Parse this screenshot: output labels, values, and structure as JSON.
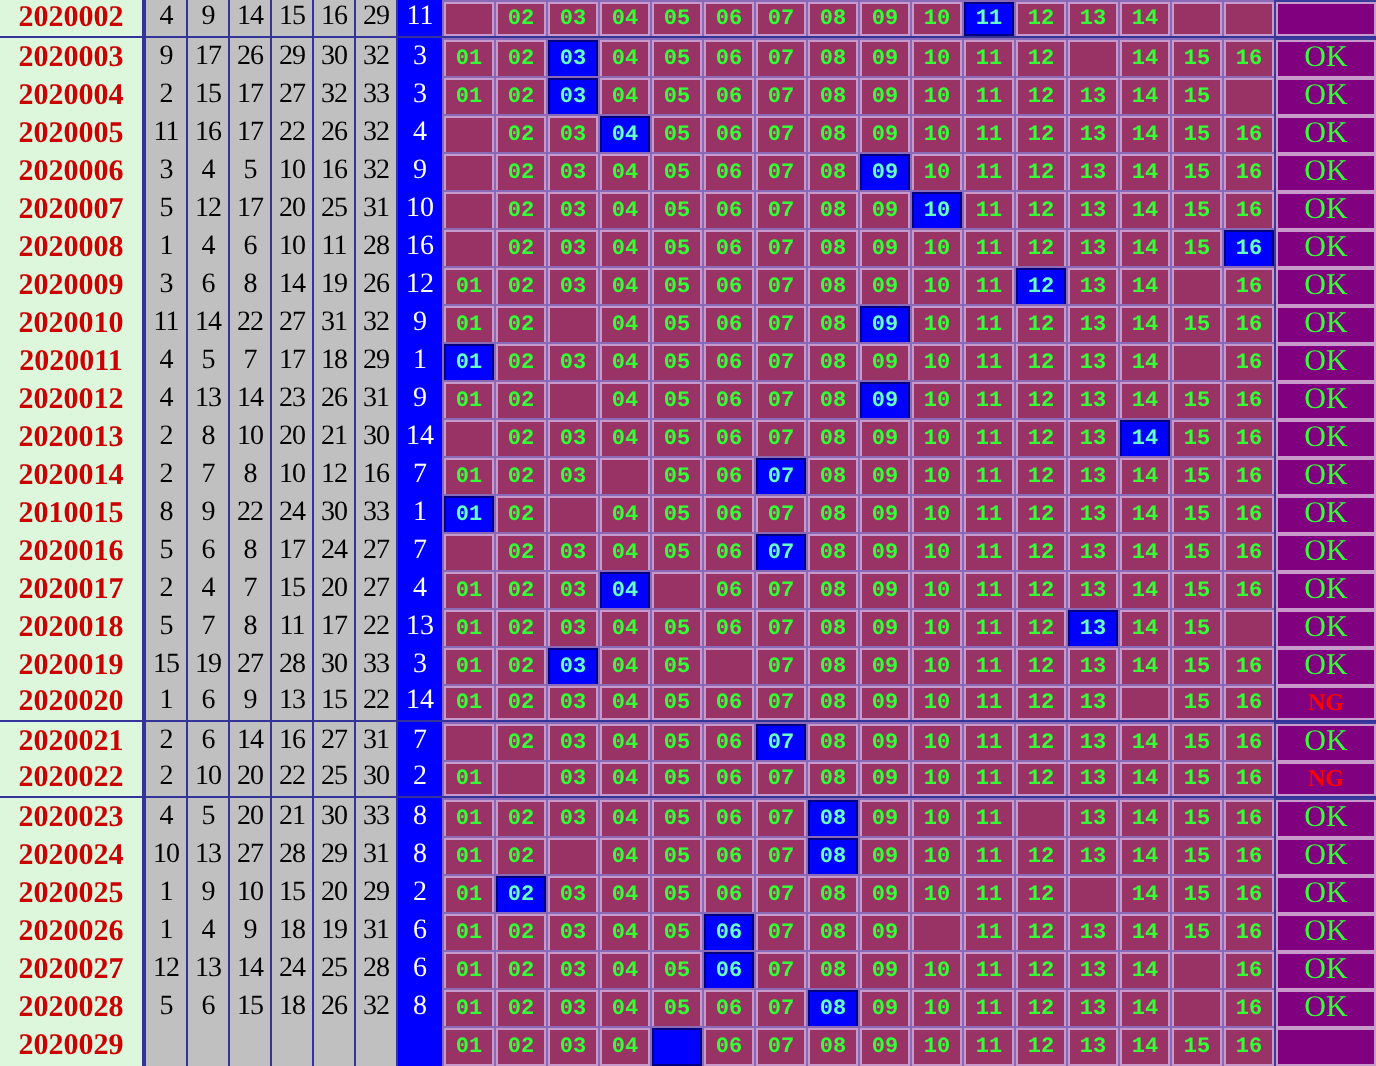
{
  "rows": [
    {
      "issue": "2020002",
      "reds": [
        "4",
        "9",
        "14",
        "15",
        "16",
        "29"
      ],
      "blue": "11",
      "cells": [
        {
          "hit": false
        },
        {
          "text": "02",
          "hit": false
        },
        {
          "text": "03",
          "hit": false
        },
        {
          "text": "04",
          "hit": false
        },
        {
          "text": "05",
          "hit": false
        },
        {
          "text": "06",
          "hit": false
        },
        {
          "text": "07",
          "hit": false
        },
        {
          "text": "08",
          "hit": false
        },
        {
          "text": "09",
          "hit": false
        },
        {
          "text": "10",
          "hit": false
        },
        {
          "text": "11",
          "hit": true
        },
        {
          "text": "12",
          "hit": false
        },
        {
          "text": "13",
          "hit": false
        },
        {
          "text": "14",
          "hit": false
        },
        {
          "hit": false
        },
        {
          "hit": false
        }
      ]
    },
    {
      "issue": "2020003",
      "reds": [
        "9",
        "17",
        "26",
        "29",
        "30",
        "32"
      ],
      "blue": "3",
      "cells": [
        {
          "text": "01",
          "hit": false
        },
        {
          "text": "02",
          "hit": false
        },
        {
          "text": "03",
          "hit": true
        },
        {
          "text": "04",
          "hit": false
        },
        {
          "text": "05",
          "hit": false
        },
        {
          "text": "06",
          "hit": false
        },
        {
          "text": "07",
          "hit": false
        },
        {
          "text": "08",
          "hit": false
        },
        {
          "text": "09",
          "hit": false
        },
        {
          "text": "10",
          "hit": false
        },
        {
          "text": "11",
          "hit": false
        },
        {
          "text": "12",
          "hit": false
        },
        {
          "hit": false
        },
        {
          "text": "14",
          "hit": false
        },
        {
          "text": "15",
          "hit": false
        },
        {
          "text": "16",
          "hit": false
        }
      ],
      "status": {
        "text": "OK",
        "kind": "ok"
      }
    },
    {
      "issue": "2020004",
      "reds": [
        "2",
        "15",
        "17",
        "27",
        "32",
        "33"
      ],
      "blue": "3",
      "cells": [
        {
          "text": "01",
          "hit": false
        },
        {
          "text": "02",
          "hit": false
        },
        {
          "text": "03",
          "hit": true
        },
        {
          "text": "04",
          "hit": false
        },
        {
          "text": "05",
          "hit": false
        },
        {
          "text": "06",
          "hit": false
        },
        {
          "text": "07",
          "hit": false
        },
        {
          "text": "08",
          "hit": false
        },
        {
          "text": "09",
          "hit": false
        },
        {
          "text": "10",
          "hit": false
        },
        {
          "text": "11",
          "hit": false
        },
        {
          "text": "12",
          "hit": false
        },
        {
          "text": "13",
          "hit": false
        },
        {
          "text": "14",
          "hit": false
        },
        {
          "text": "15",
          "hit": false
        },
        {
          "hit": false
        }
      ],
      "status": {
        "text": "OK",
        "kind": "ok"
      }
    },
    {
      "issue": "2020005",
      "reds": [
        "11",
        "16",
        "17",
        "22",
        "26",
        "32"
      ],
      "blue": "4",
      "cells": [
        {
          "hit": false
        },
        {
          "text": "02",
          "hit": false
        },
        {
          "text": "03",
          "hit": false
        },
        {
          "text": "04",
          "hit": true
        },
        {
          "text": "05",
          "hit": false
        },
        {
          "text": "06",
          "hit": false
        },
        {
          "text": "07",
          "hit": false
        },
        {
          "text": "08",
          "hit": false
        },
        {
          "text": "09",
          "hit": false
        },
        {
          "text": "10",
          "hit": false
        },
        {
          "text": "11",
          "hit": false
        },
        {
          "text": "12",
          "hit": false
        },
        {
          "text": "13",
          "hit": false
        },
        {
          "text": "14",
          "hit": false
        },
        {
          "text": "15",
          "hit": false
        },
        {
          "text": "16",
          "hit": false
        }
      ],
      "status": {
        "text": "OK",
        "kind": "ok"
      }
    },
    {
      "issue": "2020006",
      "reds": [
        "3",
        "4",
        "5",
        "10",
        "16",
        "32"
      ],
      "blue": "9",
      "cells": [
        {
          "hit": false
        },
        {
          "text": "02",
          "hit": false
        },
        {
          "text": "03",
          "hit": false
        },
        {
          "text": "04",
          "hit": false
        },
        {
          "text": "05",
          "hit": false
        },
        {
          "text": "06",
          "hit": false
        },
        {
          "text": "07",
          "hit": false
        },
        {
          "text": "08",
          "hit": false
        },
        {
          "text": "09",
          "hit": true
        },
        {
          "text": "10",
          "hit": false
        },
        {
          "text": "11",
          "hit": false
        },
        {
          "text": "12",
          "hit": false
        },
        {
          "text": "13",
          "hit": false
        },
        {
          "text": "14",
          "hit": false
        },
        {
          "text": "15",
          "hit": false
        },
        {
          "text": "16",
          "hit": false
        }
      ],
      "status": {
        "text": "OK",
        "kind": "ok"
      }
    },
    {
      "issue": "2020007",
      "reds": [
        "5",
        "12",
        "17",
        "20",
        "25",
        "31"
      ],
      "blue": "10",
      "cells": [
        {
          "hit": false
        },
        {
          "text": "02",
          "hit": false
        },
        {
          "text": "03",
          "hit": false
        },
        {
          "text": "04",
          "hit": false
        },
        {
          "text": "05",
          "hit": false
        },
        {
          "text": "06",
          "hit": false
        },
        {
          "text": "07",
          "hit": false
        },
        {
          "text": "08",
          "hit": false
        },
        {
          "text": "09",
          "hit": false
        },
        {
          "text": "10",
          "hit": true
        },
        {
          "text": "11",
          "hit": false
        },
        {
          "text": "12",
          "hit": false
        },
        {
          "text": "13",
          "hit": false
        },
        {
          "text": "14",
          "hit": false
        },
        {
          "text": "15",
          "hit": false
        },
        {
          "text": "16",
          "hit": false
        }
      ],
      "status": {
        "text": "OK",
        "kind": "ok"
      }
    },
    {
      "issue": "2020008",
      "reds": [
        "1",
        "4",
        "6",
        "10",
        "11",
        "28"
      ],
      "blue": "16",
      "cells": [
        {
          "hit": false
        },
        {
          "text": "02",
          "hit": false
        },
        {
          "text": "03",
          "hit": false
        },
        {
          "text": "04",
          "hit": false
        },
        {
          "text": "05",
          "hit": false
        },
        {
          "text": "06",
          "hit": false
        },
        {
          "text": "07",
          "hit": false
        },
        {
          "text": "08",
          "hit": false
        },
        {
          "text": "09",
          "hit": false
        },
        {
          "text": "10",
          "hit": false
        },
        {
          "text": "11",
          "hit": false
        },
        {
          "text": "12",
          "hit": false
        },
        {
          "text": "13",
          "hit": false
        },
        {
          "text": "14",
          "hit": false
        },
        {
          "text": "15",
          "hit": false
        },
        {
          "text": "16",
          "hit": true
        }
      ],
      "status": {
        "text": "OK",
        "kind": "ok"
      }
    },
    {
      "issue": "2020009",
      "reds": [
        "3",
        "6",
        "8",
        "14",
        "19",
        "26"
      ],
      "blue": "12",
      "cells": [
        {
          "text": "01",
          "hit": false
        },
        {
          "text": "02",
          "hit": false
        },
        {
          "text": "03",
          "hit": false
        },
        {
          "text": "04",
          "hit": false
        },
        {
          "text": "05",
          "hit": false
        },
        {
          "text": "06",
          "hit": false
        },
        {
          "text": "07",
          "hit": false
        },
        {
          "text": "08",
          "hit": false
        },
        {
          "text": "09",
          "hit": false
        },
        {
          "text": "10",
          "hit": false
        },
        {
          "text": "11",
          "hit": false
        },
        {
          "text": "12",
          "hit": true
        },
        {
          "text": "13",
          "hit": false
        },
        {
          "text": "14",
          "hit": false
        },
        {
          "hit": false
        },
        {
          "text": "16",
          "hit": false
        }
      ],
      "status": {
        "text": "OK",
        "kind": "ok"
      }
    },
    {
      "issue": "2020010",
      "reds": [
        "11",
        "14",
        "22",
        "27",
        "31",
        "32"
      ],
      "blue": "9",
      "cells": [
        {
          "text": "01",
          "hit": false
        },
        {
          "text": "02",
          "hit": false
        },
        {
          "hit": false
        },
        {
          "text": "04",
          "hit": false
        },
        {
          "text": "05",
          "hit": false
        },
        {
          "text": "06",
          "hit": false
        },
        {
          "text": "07",
          "hit": false
        },
        {
          "text": "08",
          "hit": false
        },
        {
          "text": "09",
          "hit": true
        },
        {
          "text": "10",
          "hit": false
        },
        {
          "text": "11",
          "hit": false
        },
        {
          "text": "12",
          "hit": false
        },
        {
          "text": "13",
          "hit": false
        },
        {
          "text": "14",
          "hit": false
        },
        {
          "text": "15",
          "hit": false
        },
        {
          "text": "16",
          "hit": false
        }
      ],
      "status": {
        "text": "OK",
        "kind": "ok"
      }
    },
    {
      "issue": "2020011",
      "reds": [
        "4",
        "5",
        "7",
        "17",
        "18",
        "29"
      ],
      "blue": "1",
      "cells": [
        {
          "text": "01",
          "hit": true
        },
        {
          "text": "02",
          "hit": false
        },
        {
          "text": "03",
          "hit": false
        },
        {
          "text": "04",
          "hit": false
        },
        {
          "text": "05",
          "hit": false
        },
        {
          "text": "06",
          "hit": false
        },
        {
          "text": "07",
          "hit": false
        },
        {
          "text": "08",
          "hit": false
        },
        {
          "text": "09",
          "hit": false
        },
        {
          "text": "10",
          "hit": false
        },
        {
          "text": "11",
          "hit": false
        },
        {
          "text": "12",
          "hit": false
        },
        {
          "text": "13",
          "hit": false
        },
        {
          "text": "14",
          "hit": false
        },
        {
          "hit": false
        },
        {
          "text": "16",
          "hit": false
        }
      ],
      "status": {
        "text": "OK",
        "kind": "ok"
      }
    },
    {
      "issue": "2020012",
      "reds": [
        "4",
        "13",
        "14",
        "23",
        "26",
        "31"
      ],
      "blue": "9",
      "cells": [
        {
          "text": "01",
          "hit": false
        },
        {
          "text": "02",
          "hit": false
        },
        {
          "hit": false
        },
        {
          "text": "04",
          "hit": false
        },
        {
          "text": "05",
          "hit": false
        },
        {
          "text": "06",
          "hit": false
        },
        {
          "text": "07",
          "hit": false
        },
        {
          "text": "08",
          "hit": false
        },
        {
          "text": "09",
          "hit": true
        },
        {
          "text": "10",
          "hit": false
        },
        {
          "text": "11",
          "hit": false
        },
        {
          "text": "12",
          "hit": false
        },
        {
          "text": "13",
          "hit": false
        },
        {
          "text": "14",
          "hit": false
        },
        {
          "text": "15",
          "hit": false
        },
        {
          "text": "16",
          "hit": false
        }
      ],
      "status": {
        "text": "OK",
        "kind": "ok"
      }
    },
    {
      "issue": "2020013",
      "reds": [
        "2",
        "8",
        "10",
        "20",
        "21",
        "30"
      ],
      "blue": "14",
      "cells": [
        {
          "hit": false
        },
        {
          "text": "02",
          "hit": false
        },
        {
          "text": "03",
          "hit": false
        },
        {
          "text": "04",
          "hit": false
        },
        {
          "text": "05",
          "hit": false
        },
        {
          "text": "06",
          "hit": false
        },
        {
          "text": "07",
          "hit": false
        },
        {
          "text": "08",
          "hit": false
        },
        {
          "text": "09",
          "hit": false
        },
        {
          "text": "10",
          "hit": false
        },
        {
          "text": "11",
          "hit": false
        },
        {
          "text": "12",
          "hit": false
        },
        {
          "text": "13",
          "hit": false
        },
        {
          "text": "14",
          "hit": true
        },
        {
          "text": "15",
          "hit": false
        },
        {
          "text": "16",
          "hit": false
        }
      ],
      "status": {
        "text": "OK",
        "kind": "ok"
      }
    },
    {
      "issue": "2020014",
      "reds": [
        "2",
        "7",
        "8",
        "10",
        "12",
        "16"
      ],
      "blue": "7",
      "cells": [
        {
          "text": "01",
          "hit": false
        },
        {
          "text": "02",
          "hit": false
        },
        {
          "text": "03",
          "hit": false
        },
        {
          "hit": false
        },
        {
          "text": "05",
          "hit": false
        },
        {
          "text": "06",
          "hit": false
        },
        {
          "text": "07",
          "hit": true
        },
        {
          "text": "08",
          "hit": false
        },
        {
          "text": "09",
          "hit": false
        },
        {
          "text": "10",
          "hit": false
        },
        {
          "text": "11",
          "hit": false
        },
        {
          "text": "12",
          "hit": false
        },
        {
          "text": "13",
          "hit": false
        },
        {
          "text": "14",
          "hit": false
        },
        {
          "text": "15",
          "hit": false
        },
        {
          "text": "16",
          "hit": false
        }
      ],
      "status": {
        "text": "OK",
        "kind": "ok"
      }
    },
    {
      "issue": "2010015",
      "reds": [
        "8",
        "9",
        "22",
        "24",
        "30",
        "33"
      ],
      "blue": "1",
      "cells": [
        {
          "text": "01",
          "hit": true
        },
        {
          "text": "02",
          "hit": false
        },
        {
          "hit": false
        },
        {
          "text": "04",
          "hit": false
        },
        {
          "text": "05",
          "hit": false
        },
        {
          "text": "06",
          "hit": false
        },
        {
          "text": "07",
          "hit": false
        },
        {
          "text": "08",
          "hit": false
        },
        {
          "text": "09",
          "hit": false
        },
        {
          "text": "10",
          "hit": false
        },
        {
          "text": "11",
          "hit": false
        },
        {
          "text": "12",
          "hit": false
        },
        {
          "text": "13",
          "hit": false
        },
        {
          "text": "14",
          "hit": false
        },
        {
          "text": "15",
          "hit": false
        },
        {
          "text": "16",
          "hit": false
        }
      ],
      "status": {
        "text": "OK",
        "kind": "ok"
      }
    },
    {
      "issue": "2020016",
      "reds": [
        "5",
        "6",
        "8",
        "17",
        "24",
        "27"
      ],
      "blue": "7",
      "cells": [
        {
          "hit": false
        },
        {
          "text": "02",
          "hit": false
        },
        {
          "text": "03",
          "hit": false
        },
        {
          "text": "04",
          "hit": false
        },
        {
          "text": "05",
          "hit": false
        },
        {
          "text": "06",
          "hit": false
        },
        {
          "text": "07",
          "hit": true
        },
        {
          "text": "08",
          "hit": false
        },
        {
          "text": "09",
          "hit": false
        },
        {
          "text": "10",
          "hit": false
        },
        {
          "text": "11",
          "hit": false
        },
        {
          "text": "12",
          "hit": false
        },
        {
          "text": "13",
          "hit": false
        },
        {
          "text": "14",
          "hit": false
        },
        {
          "text": "15",
          "hit": false
        },
        {
          "text": "16",
          "hit": false
        }
      ],
      "status": {
        "text": "OK",
        "kind": "ok"
      }
    },
    {
      "issue": "2020017",
      "reds": [
        "2",
        "4",
        "7",
        "15",
        "20",
        "27"
      ],
      "blue": "4",
      "cells": [
        {
          "text": "01",
          "hit": false
        },
        {
          "text": "02",
          "hit": false
        },
        {
          "text": "03",
          "hit": false
        },
        {
          "text": "04",
          "hit": true
        },
        {
          "hit": false
        },
        {
          "text": "06",
          "hit": false
        },
        {
          "text": "07",
          "hit": false
        },
        {
          "text": "08",
          "hit": false
        },
        {
          "text": "09",
          "hit": false
        },
        {
          "text": "10",
          "hit": false
        },
        {
          "text": "11",
          "hit": false
        },
        {
          "text": "12",
          "hit": false
        },
        {
          "text": "13",
          "hit": false
        },
        {
          "text": "14",
          "hit": false
        },
        {
          "text": "15",
          "hit": false
        },
        {
          "text": "16",
          "hit": false
        }
      ],
      "status": {
        "text": "OK",
        "kind": "ok"
      }
    },
    {
      "issue": "2020018",
      "reds": [
        "5",
        "7",
        "8",
        "11",
        "17",
        "22"
      ],
      "blue": "13",
      "cells": [
        {
          "text": "01",
          "hit": false
        },
        {
          "text": "02",
          "hit": false
        },
        {
          "text": "03",
          "hit": false
        },
        {
          "text": "04",
          "hit": false
        },
        {
          "text": "05",
          "hit": false
        },
        {
          "text": "06",
          "hit": false
        },
        {
          "text": "07",
          "hit": false
        },
        {
          "text": "08",
          "hit": false
        },
        {
          "text": "09",
          "hit": false
        },
        {
          "text": "10",
          "hit": false
        },
        {
          "text": "11",
          "hit": false
        },
        {
          "text": "12",
          "hit": false
        },
        {
          "text": "13",
          "hit": true
        },
        {
          "text": "14",
          "hit": false
        },
        {
          "text": "15",
          "hit": false
        },
        {
          "hit": false
        }
      ],
      "status": {
        "text": "OK",
        "kind": "ok"
      }
    },
    {
      "issue": "2020019",
      "reds": [
        "15",
        "19",
        "27",
        "28",
        "30",
        "33"
      ],
      "blue": "3",
      "cells": [
        {
          "text": "01",
          "hit": false
        },
        {
          "text": "02",
          "hit": false
        },
        {
          "text": "03",
          "hit": true
        },
        {
          "text": "04",
          "hit": false
        },
        {
          "text": "05",
          "hit": false
        },
        {
          "hit": false
        },
        {
          "text": "07",
          "hit": false
        },
        {
          "text": "08",
          "hit": false
        },
        {
          "text": "09",
          "hit": false
        },
        {
          "text": "10",
          "hit": false
        },
        {
          "text": "11",
          "hit": false
        },
        {
          "text": "12",
          "hit": false
        },
        {
          "text": "13",
          "hit": false
        },
        {
          "text": "14",
          "hit": false
        },
        {
          "text": "15",
          "hit": false
        },
        {
          "text": "16",
          "hit": false
        }
      ],
      "status": {
        "text": "OK",
        "kind": "ok"
      }
    },
    {
      "issue": "2020020",
      "reds": [
        "1",
        "6",
        "9",
        "13",
        "15",
        "22"
      ],
      "blue": "14",
      "cells": [
        {
          "text": "01",
          "hit": false
        },
        {
          "text": "02",
          "hit": false
        },
        {
          "text": "03",
          "hit": false
        },
        {
          "text": "04",
          "hit": false
        },
        {
          "text": "05",
          "hit": false
        },
        {
          "text": "06",
          "hit": false
        },
        {
          "text": "07",
          "hit": false
        },
        {
          "text": "08",
          "hit": false
        },
        {
          "text": "09",
          "hit": false
        },
        {
          "text": "10",
          "hit": false
        },
        {
          "text": "11",
          "hit": false
        },
        {
          "text": "12",
          "hit": false
        },
        {
          "text": "13",
          "hit": false
        },
        {
          "hit": false
        },
        {
          "text": "15",
          "hit": false
        },
        {
          "text": "16",
          "hit": false
        }
      ],
      "status": {
        "text": "NG",
        "kind": "ng"
      }
    },
    {
      "issue": "2020021",
      "reds": [
        "2",
        "6",
        "14",
        "16",
        "27",
        "31"
      ],
      "blue": "7",
      "cells": [
        {
          "hit": false
        },
        {
          "text": "02",
          "hit": false
        },
        {
          "text": "03",
          "hit": false
        },
        {
          "text": "04",
          "hit": false
        },
        {
          "text": "05",
          "hit": false
        },
        {
          "text": "06",
          "hit": false
        },
        {
          "text": "07",
          "hit": true
        },
        {
          "text": "08",
          "hit": false
        },
        {
          "text": "09",
          "hit": false
        },
        {
          "text": "10",
          "hit": false
        },
        {
          "text": "11",
          "hit": false
        },
        {
          "text": "12",
          "hit": false
        },
        {
          "text": "13",
          "hit": false
        },
        {
          "text": "14",
          "hit": false
        },
        {
          "text": "15",
          "hit": false
        },
        {
          "text": "16",
          "hit": false
        }
      ],
      "status": {
        "text": "OK",
        "kind": "ok"
      }
    },
    {
      "issue": "2020022",
      "reds": [
        "2",
        "10",
        "20",
        "22",
        "25",
        "30"
      ],
      "blue": "2",
      "cells": [
        {
          "text": "01",
          "hit": false
        },
        {
          "hit": false
        },
        {
          "text": "03",
          "hit": false
        },
        {
          "text": "04",
          "hit": false
        },
        {
          "text": "05",
          "hit": false
        },
        {
          "text": "06",
          "hit": false
        },
        {
          "text": "07",
          "hit": false
        },
        {
          "text": "08",
          "hit": false
        },
        {
          "text": "09",
          "hit": false
        },
        {
          "text": "10",
          "hit": false
        },
        {
          "text": "11",
          "hit": false
        },
        {
          "text": "12",
          "hit": false
        },
        {
          "text": "13",
          "hit": false
        },
        {
          "text": "14",
          "hit": false
        },
        {
          "text": "15",
          "hit": false
        },
        {
          "text": "16",
          "hit": false
        }
      ],
      "status": {
        "text": "NG",
        "kind": "ng"
      }
    },
    {
      "issue": "2020023",
      "reds": [
        "4",
        "5",
        "20",
        "21",
        "30",
        "33"
      ],
      "blue": "8",
      "cells": [
        {
          "text": "01",
          "hit": false
        },
        {
          "text": "02",
          "hit": false
        },
        {
          "text": "03",
          "hit": false
        },
        {
          "text": "04",
          "hit": false
        },
        {
          "text": "05",
          "hit": false
        },
        {
          "text": "06",
          "hit": false
        },
        {
          "text": "07",
          "hit": false
        },
        {
          "text": "08",
          "hit": true
        },
        {
          "text": "09",
          "hit": false
        },
        {
          "text": "10",
          "hit": false
        },
        {
          "text": "11",
          "hit": false
        },
        {
          "hit": false
        },
        {
          "text": "13",
          "hit": false
        },
        {
          "text": "14",
          "hit": false
        },
        {
          "text": "15",
          "hit": false
        },
        {
          "text": "16",
          "hit": false
        }
      ],
      "status": {
        "text": "OK",
        "kind": "ok"
      }
    },
    {
      "issue": "2020024",
      "reds": [
        "10",
        "13",
        "27",
        "28",
        "29",
        "31"
      ],
      "blue": "8",
      "cells": [
        {
          "text": "01",
          "hit": false
        },
        {
          "text": "02",
          "hit": false
        },
        {
          "hit": false
        },
        {
          "text": "04",
          "hit": false
        },
        {
          "text": "05",
          "hit": false
        },
        {
          "text": "06",
          "hit": false
        },
        {
          "text": "07",
          "hit": false
        },
        {
          "text": "08",
          "hit": true
        },
        {
          "text": "09",
          "hit": false
        },
        {
          "text": "10",
          "hit": false
        },
        {
          "text": "11",
          "hit": false
        },
        {
          "text": "12",
          "hit": false
        },
        {
          "text": "13",
          "hit": false
        },
        {
          "text": "14",
          "hit": false
        },
        {
          "text": "15",
          "hit": false
        },
        {
          "text": "16",
          "hit": false
        }
      ],
      "status": {
        "text": "OK",
        "kind": "ok"
      }
    },
    {
      "issue": "2020025",
      "reds": [
        "1",
        "9",
        "10",
        "15",
        "20",
        "29"
      ],
      "blue": "2",
      "cells": [
        {
          "text": "01",
          "hit": false
        },
        {
          "text": "02",
          "hit": true
        },
        {
          "text": "03",
          "hit": false
        },
        {
          "text": "04",
          "hit": false
        },
        {
          "text": "05",
          "hit": false
        },
        {
          "text": "06",
          "hit": false
        },
        {
          "text": "07",
          "hit": false
        },
        {
          "text": "08",
          "hit": false
        },
        {
          "text": "09",
          "hit": false
        },
        {
          "text": "10",
          "hit": false
        },
        {
          "text": "11",
          "hit": false
        },
        {
          "text": "12",
          "hit": false
        },
        {
          "hit": false
        },
        {
          "text": "14",
          "hit": false
        },
        {
          "text": "15",
          "hit": false
        },
        {
          "text": "16",
          "hit": false
        }
      ],
      "status": {
        "text": "OK",
        "kind": "ok"
      }
    },
    {
      "issue": "2020026",
      "reds": [
        "1",
        "4",
        "9",
        "18",
        "19",
        "31"
      ],
      "blue": "6",
      "cells": [
        {
          "text": "01",
          "hit": false
        },
        {
          "text": "02",
          "hit": false
        },
        {
          "text": "03",
          "hit": false
        },
        {
          "text": "04",
          "hit": false
        },
        {
          "text": "05",
          "hit": false
        },
        {
          "text": "06",
          "hit": true
        },
        {
          "text": "07",
          "hit": false
        },
        {
          "text": "08",
          "hit": false
        },
        {
          "text": "09",
          "hit": false
        },
        {
          "hit": false
        },
        {
          "text": "11",
          "hit": false
        },
        {
          "text": "12",
          "hit": false
        },
        {
          "text": "13",
          "hit": false
        },
        {
          "text": "14",
          "hit": false
        },
        {
          "text": "15",
          "hit": false
        },
        {
          "text": "16",
          "hit": false
        }
      ],
      "status": {
        "text": "OK",
        "kind": "ok"
      }
    },
    {
      "issue": "2020027",
      "reds": [
        "12",
        "13",
        "14",
        "24",
        "25",
        "28"
      ],
      "blue": "6",
      "cells": [
        {
          "text": "01",
          "hit": false
        },
        {
          "text": "02",
          "hit": false
        },
        {
          "text": "03",
          "hit": false
        },
        {
          "text": "04",
          "hit": false
        },
        {
          "text": "05",
          "hit": false
        },
        {
          "text": "06",
          "hit": true
        },
        {
          "text": "07",
          "hit": false
        },
        {
          "text": "08",
          "hit": false
        },
        {
          "text": "09",
          "hit": false
        },
        {
          "text": "10",
          "hit": false
        },
        {
          "text": "11",
          "hit": false
        },
        {
          "text": "12",
          "hit": false
        },
        {
          "text": "13",
          "hit": false
        },
        {
          "text": "14",
          "hit": false
        },
        {
          "hit": false
        },
        {
          "text": "16",
          "hit": false
        }
      ],
      "status": {
        "text": "OK",
        "kind": "ok"
      }
    },
    {
      "issue": "2020028",
      "reds": [
        "5",
        "6",
        "15",
        "18",
        "26",
        "32"
      ],
      "blue": "8",
      "cells": [
        {
          "text": "01",
          "hit": false
        },
        {
          "text": "02",
          "hit": false
        },
        {
          "text": "03",
          "hit": false
        },
        {
          "text": "04",
          "hit": false
        },
        {
          "text": "05",
          "hit": false
        },
        {
          "text": "06",
          "hit": false
        },
        {
          "text": "07",
          "hit": false
        },
        {
          "text": "08",
          "hit": true
        },
        {
          "text": "09",
          "hit": false
        },
        {
          "text": "10",
          "hit": false
        },
        {
          "text": "11",
          "hit": false
        },
        {
          "text": "12",
          "hit": false
        },
        {
          "text": "13",
          "hit": false
        },
        {
          "text": "14",
          "hit": false
        },
        {
          "hit": false
        },
        {
          "text": "16",
          "hit": false
        }
      ],
      "status": {
        "text": "OK",
        "kind": "ok"
      }
    },
    {
      "issue": "2020029",
      "cells": [
        {
          "text": "01",
          "hit": false
        },
        {
          "text": "02",
          "hit": false
        },
        {
          "text": "03",
          "hit": false
        },
        {
          "text": "04",
          "hit": false
        },
        {
          "hit": true
        },
        {
          "text": "06",
          "hit": false
        },
        {
          "text": "07",
          "hit": false
        },
        {
          "text": "08",
          "hit": false
        },
        {
          "text": "09",
          "hit": false
        },
        {
          "text": "10",
          "hit": false
        },
        {
          "text": "11",
          "hit": false
        },
        {
          "text": "12",
          "hit": false
        },
        {
          "text": "13",
          "hit": false
        },
        {
          "text": "14",
          "hit": false
        },
        {
          "text": "15",
          "hit": false
        },
        {
          "text": "16",
          "hit": false
        }
      ]
    }
  ]
}
